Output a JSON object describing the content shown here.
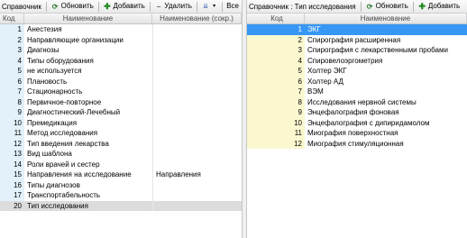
{
  "left": {
    "toolbar": {
      "title": "Справочник",
      "refresh_label": "Обновить",
      "add_label": "Добавить",
      "delete_label": "Удалить",
      "extra_label": "Все"
    },
    "columns": {
      "code": "Код",
      "name": "Наименование",
      "short": "Наименование (сокр.)"
    },
    "rows": [
      {
        "code": "1",
        "name": "Анестезия",
        "short": ""
      },
      {
        "code": "2",
        "name": "Направляющие организации",
        "short": ""
      },
      {
        "code": "3",
        "name": "Диагнозы",
        "short": ""
      },
      {
        "code": "4",
        "name": "Типы оборудования",
        "short": ""
      },
      {
        "code": "5",
        "name": "не используется",
        "short": ""
      },
      {
        "code": "6",
        "name": "Плановость",
        "short": ""
      },
      {
        "code": "7",
        "name": "Стационарность",
        "short": ""
      },
      {
        "code": "8",
        "name": "Первичное-повторное",
        "short": ""
      },
      {
        "code": "9",
        "name": "Диагностический-Лечебный",
        "short": ""
      },
      {
        "code": "10",
        "name": "Премедикация",
        "short": ""
      },
      {
        "code": "11",
        "name": "Метод исследования",
        "short": ""
      },
      {
        "code": "12",
        "name": "Тип введения лекарства",
        "short": ""
      },
      {
        "code": "13",
        "name": "Вид шаблона",
        "short": ""
      },
      {
        "code": "14",
        "name": "Роли врачей и сестер",
        "short": ""
      },
      {
        "code": "15",
        "name": "Направления на исследование",
        "short": "Направления"
      },
      {
        "code": "16",
        "name": "Типы диагнозов",
        "short": ""
      },
      {
        "code": "17",
        "name": "Транспортабельность",
        "short": ""
      },
      {
        "code": "20",
        "name": "Тип исследования",
        "short": ""
      }
    ],
    "selected_index": 17
  },
  "right": {
    "toolbar": {
      "title": "Справочник : Тип исследования",
      "refresh_label": "Обновить",
      "add_label": "Добавить"
    },
    "columns": {
      "code": "Код",
      "name": "Наименование"
    },
    "rows": [
      {
        "code": "1",
        "name": "ЭКГ"
      },
      {
        "code": "2",
        "name": "Спирография расширенная"
      },
      {
        "code": "3",
        "name": "Спирография с лекарственными пробами"
      },
      {
        "code": "4",
        "name": "Спировелоэргометрия"
      },
      {
        "code": "5",
        "name": "Холтер ЭКГ"
      },
      {
        "code": "6",
        "name": "Холтер АД"
      },
      {
        "code": "7",
        "name": "ВЭМ"
      },
      {
        "code": "8",
        "name": "Исследования нервной системы"
      },
      {
        "code": "9",
        "name": "Энцефалография фоновая"
      },
      {
        "code": "10",
        "name": "Энцефалография с дипиридамолом"
      },
      {
        "code": "11",
        "name": "Миография поверхностная"
      },
      {
        "code": "12",
        "name": "Миография стимуляционная"
      }
    ],
    "selected_index": 0
  },
  "colors": {
    "left_code_bg": "#e2f1fa",
    "right_code_bg": "#fbf8d0",
    "right_selected": "#3797f5",
    "left_selected": "#dcdcdc"
  }
}
